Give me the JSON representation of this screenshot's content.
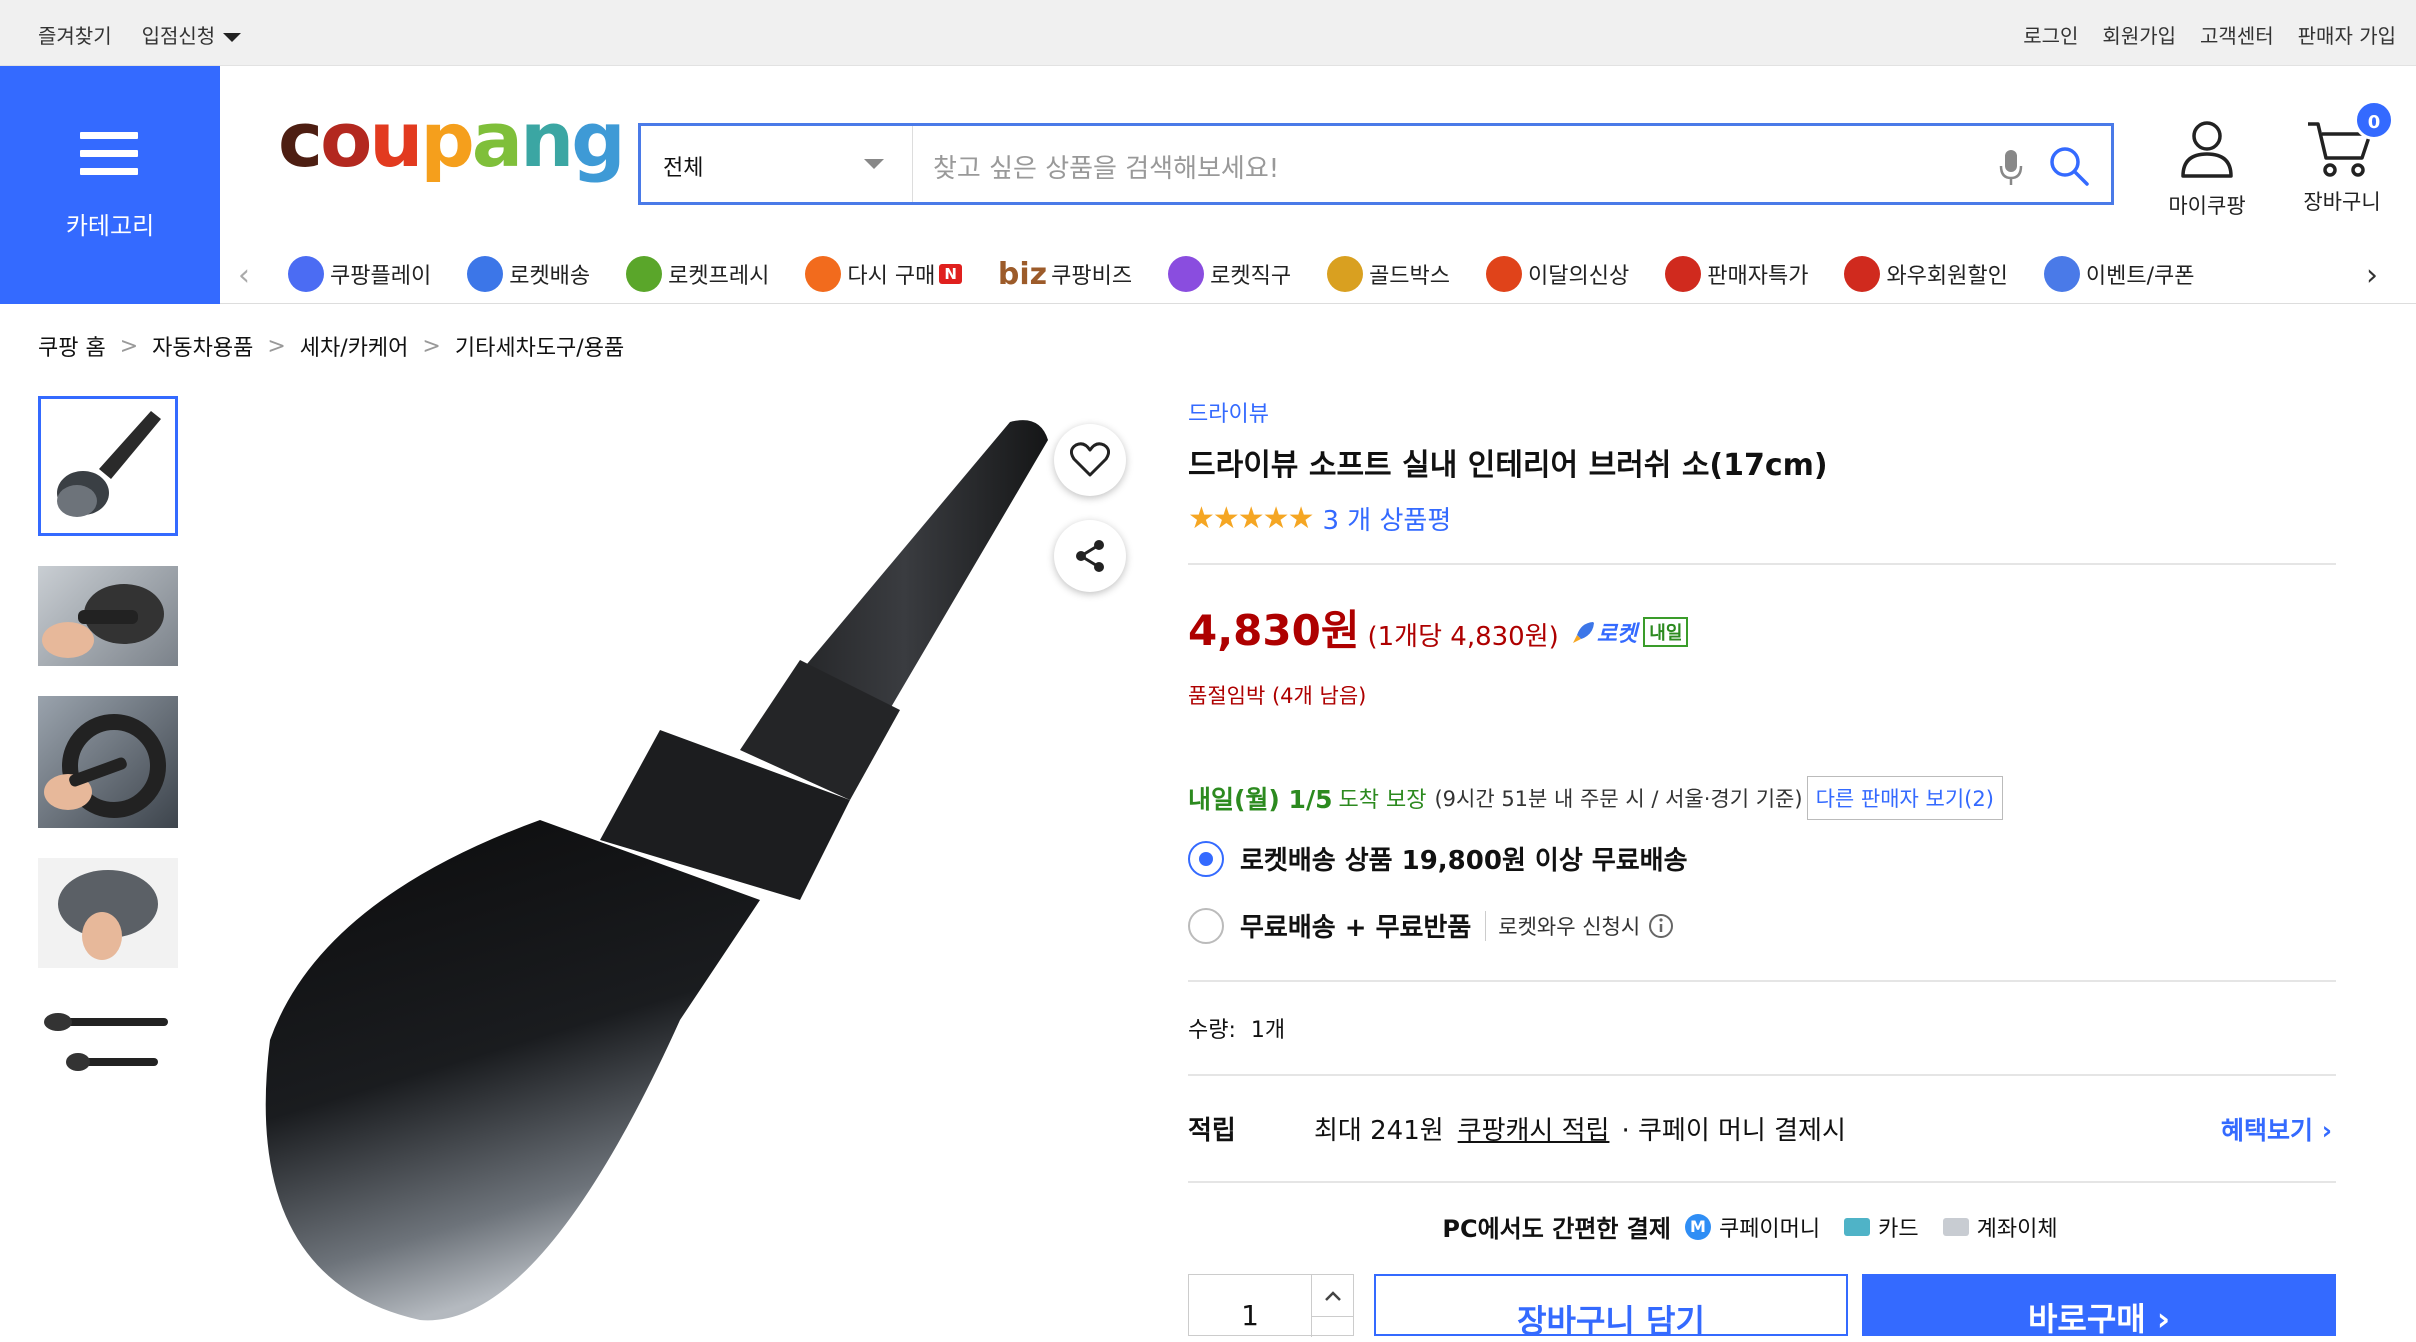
{
  "topbar": {
    "left": [
      "즐겨찾기",
      "입점신청"
    ],
    "right": [
      "로그인",
      "회원가입",
      "고객센터",
      "판매자 가입"
    ]
  },
  "header": {
    "category_label": "카테고리",
    "logo": [
      "c",
      "o",
      "u",
      "p",
      "a",
      "n",
      "g"
    ],
    "logo_colors": [
      "#4d1e12",
      "#b3281f",
      "#e23a1f",
      "#f59f1c",
      "#7fbf3a",
      "#3ba6a3",
      "#3e9ad6"
    ],
    "search_category": "전체",
    "search_placeholder": "찾고 싶은 상품을 검색해보세요!",
    "mycoupang_label": "마이쿠팡",
    "cart_label": "장바구니",
    "cart_count": "0"
  },
  "nav": {
    "items": [
      {
        "label": "쿠팡플레이",
        "icon": "play-icon",
        "color": "#4b6cf3"
      },
      {
        "label": "로켓배송",
        "icon": "rocket-icon",
        "color": "#3c76e8"
      },
      {
        "label": "로켓프레시",
        "icon": "rocket-fresh-icon",
        "color": "#5aa62a"
      },
      {
        "label": "다시 구매",
        "icon": "rebuy-icon",
        "color": "#f26b1d",
        "badge": "N"
      },
      {
        "label": "쿠팡비즈",
        "icon": "biz-icon",
        "color": "#9c5b2a",
        "prefix": "biz"
      },
      {
        "label": "로켓직구",
        "icon": "rocket-direct-icon",
        "color": "#8a4ddf"
      },
      {
        "label": "골드박스",
        "icon": "goldbox-icon",
        "color": "#d9a020"
      },
      {
        "label": "이달의신상",
        "icon": "new-icon",
        "color": "#e0431a"
      },
      {
        "label": "판매자특가",
        "icon": "percent-icon",
        "color": "#d02a1e"
      },
      {
        "label": "와우회원할인",
        "icon": "wow-icon",
        "color": "#d02a1e"
      },
      {
        "label": "이벤트/쿠폰",
        "icon": "coupon-icon",
        "color": "#4a7ae8"
      }
    ]
  },
  "breadcrumb": [
    "쿠팡 홈",
    "자동차용품",
    "세차/카케어",
    "기타세차도구/용품"
  ],
  "product": {
    "brand": "드라이뷰",
    "title": "드라이뷰 소프트 실내 인테리어 브러쉬 소(17cm)",
    "rating": 4.5,
    "stars_display": "★★★★★",
    "review_count": "3 개 상품평",
    "price": "4,830원",
    "unit_price": "(1개당 4,830원)",
    "rocket_label": "로켓",
    "rocket_badge": "내일",
    "stock_note": "품절임박 (4개 남음)",
    "delivery_date": "내일(월) 1/5",
    "delivery_guarantee": "도착 보장",
    "delivery_note": "(9시간 51분 내 주문 시 / 서울·경기 기준)",
    "other_sellers": "다른 판매자 보기(2)",
    "options": [
      {
        "label": "로켓배송 상품 19,800원 이상 무료배송",
        "selected": true,
        "sub": ""
      },
      {
        "label": "무료배송 + 무료반품",
        "selected": false,
        "sub": "로켓와우 신청시"
      }
    ],
    "quantity_label": "수량:",
    "quantity_value": "1개",
    "points_label": "적립",
    "points_max": "최대 241원",
    "points_cash": "쿠팡캐시 적립",
    "points_note": "· 쿠페이 머니 결제시",
    "benefit_link": "혜택보기",
    "pay_title": "PC에서도 간편한 결제",
    "pay_methods": [
      "쿠페이머니",
      "카드",
      "계좌이체"
    ],
    "qty_input": "1",
    "add_to_cart": "장바구니 담기",
    "buy_now": "바로구매"
  }
}
